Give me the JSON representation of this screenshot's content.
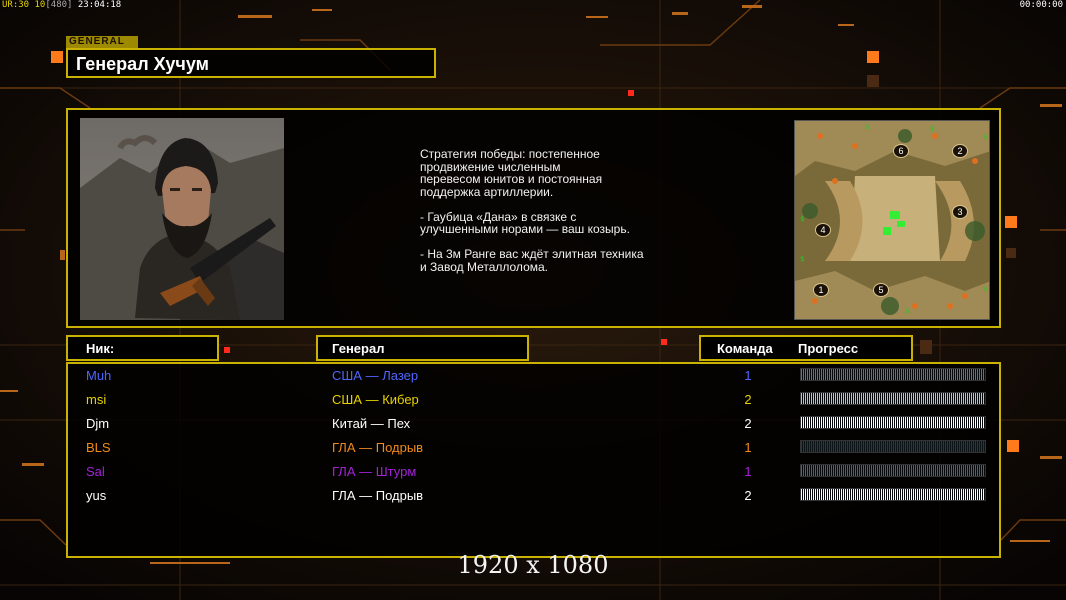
{
  "hud": {
    "left_prefix": "UR",
    "left_nums": ":30 10",
    "left_bracket": "[480]",
    "left_time": "23:04:18",
    "right_time": "00:00:00"
  },
  "general_tag": "GENERAL",
  "general_name": "Генерал Хучум",
  "description": "Стратегия победы: постепенное\nпродвижение численным\nперевесом юнитов и постоянная\nподдержка артиллерии.\n\n- Гаубица «Дана» в связке с\nулучшенными норами — ваш козырь.\n\n- На 3м Ранге вас ждёт элитная техника\nи Завод Металлолома.",
  "minimap": {
    "start_positions": [
      "1",
      "2",
      "3",
      "4",
      "5",
      "6"
    ]
  },
  "headers": {
    "nick": "Ник:",
    "general": "Генерал",
    "team": "Команда",
    "progress": "Прогресс"
  },
  "players": [
    {
      "nick": "Muh",
      "general": "США — Лазер",
      "team": "1",
      "color": "#4f66ff",
      "progress": 1.0
    },
    {
      "nick": "msi",
      "general": "США — Кибер",
      "team": "2",
      "color": "#e6d200",
      "progress": 1.0
    },
    {
      "nick": "Djm",
      "general": "Китай — Пех",
      "team": "2",
      "color": "#ffffff",
      "progress": 1.0
    },
    {
      "nick": "BLS",
      "general": "ГЛА — Подрыв",
      "team": "1",
      "color": "#f08a1c",
      "progress": 0.0
    },
    {
      "nick": "Sal",
      "general": "ГЛА — Штурм",
      "team": "1",
      "color": "#a422d8",
      "progress": 1.0
    },
    {
      "nick": "yus",
      "general": "ГЛА — Подрыв",
      "team": "2",
      "color": "#ffffff",
      "progress": 1.0
    }
  ],
  "resolution_caption": "1920 x 1080"
}
